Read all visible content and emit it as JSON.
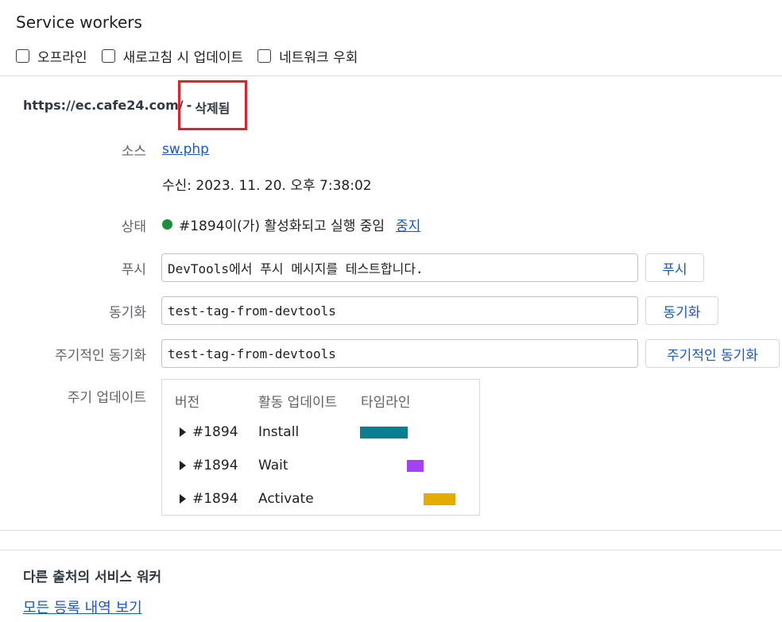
{
  "header": {
    "title": "Service workers",
    "options": [
      {
        "label": "오프라인",
        "checked": false
      },
      {
        "label": "새로고침 시 업데이트",
        "checked": false
      },
      {
        "label": "네트워크 우회",
        "checked": false
      }
    ]
  },
  "worker": {
    "scope_url": "https://ec.cafe24.com/",
    "separator": "-",
    "state_tag": "삭제됨",
    "source_label": "소스",
    "source_link": "sw.php",
    "received": "수신: 2023. 11. 20. 오후 7:38:02",
    "status_label": "상태",
    "status_text": "#1894이(가) 활성화되고 실행 중임",
    "status_action": "중지",
    "status_color": "#1e8e3e",
    "push_label": "푸시",
    "push_value": "DevTools에서 푸시 메시지를 테스트합니다.",
    "push_button": "푸시",
    "sync_label": "동기화",
    "sync_value": "test-tag-from-devtools",
    "sync_button": "동기화",
    "periodic_label": "주기적인 동기화",
    "periodic_value": "test-tag-from-devtools",
    "periodic_button": "주기적인 동기화",
    "updates_label": "주기 업데이트"
  },
  "timeline": {
    "headers": {
      "version": "버전",
      "activity": "활동 업데이트",
      "timeline": "타임라인"
    },
    "rows": [
      {
        "version": "#1894",
        "activity": "Install",
        "color": "#0b7f8f"
      },
      {
        "version": "#1894",
        "activity": "Wait",
        "color": "#a142f4"
      },
      {
        "version": "#1894",
        "activity": "Activate",
        "color": "#e5ac00"
      }
    ]
  },
  "footer": {
    "other_title": "다른 출처의 서비스 워커",
    "view_all_link": "모든 등록 내역 보기"
  }
}
